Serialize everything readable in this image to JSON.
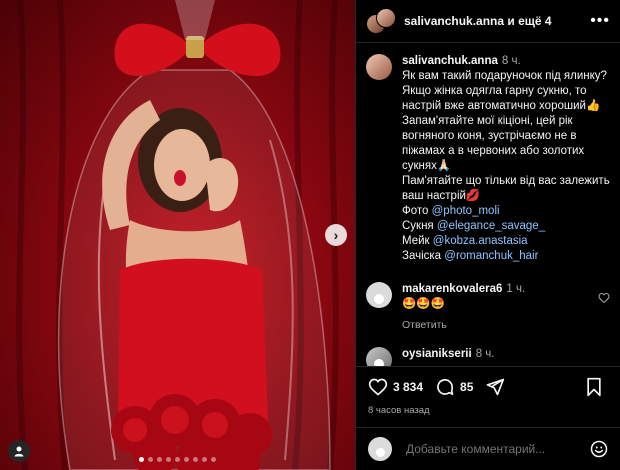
{
  "post": {
    "author": "salivanchuk.anna",
    "header_suffix": "и ещё 4",
    "caption_time": "8 ч.",
    "caption_lines": [
      "Як вам такий подаруночок під ялинку?",
      "Якщо жінка одягла гарну сукню, то настрій вже автоматично хороший👍",
      "Запам'ятайте мої кіціоні, цей рік вогняного коня, зустрічаємо не в піжамах а в червоних або золотих сукнях🙏🏻",
      "Пам'ятайте що тільки від вас залежить ваш настрій💋"
    ],
    "credits": [
      {
        "label": "Фото",
        "handle": "@photo_moli"
      },
      {
        "label": "Сукня",
        "handle": "@elegance_savage_"
      },
      {
        "label": "Мейк",
        "handle": "@kobza.anastasia"
      },
      {
        "label": "Зачіска",
        "handle": "@romanchuk_hair"
      }
    ]
  },
  "comments": [
    {
      "user": "makarenkovalera6",
      "time": "1 ч.",
      "text": "🤩🤩🤩",
      "reply": "Ответить"
    },
    {
      "user": "oysianikserii",
      "time": "8 ч.",
      "text": "",
      "reply": ""
    }
  ],
  "stats": {
    "likes": "3 834",
    "comments": "85",
    "ago": "8 часов назад"
  },
  "add_comment": {
    "placeholder": "Добавьте комментарий..."
  },
  "icons": {
    "like": "heart-icon",
    "comment": "comment-icon",
    "share": "share-icon",
    "save": "bookmark-icon",
    "more": "more-icon",
    "emoji": "emoji-icon",
    "next": "chevron-right-icon",
    "user_tag": "user-tag-icon"
  },
  "carousel": {
    "total": 9,
    "active": 0
  }
}
